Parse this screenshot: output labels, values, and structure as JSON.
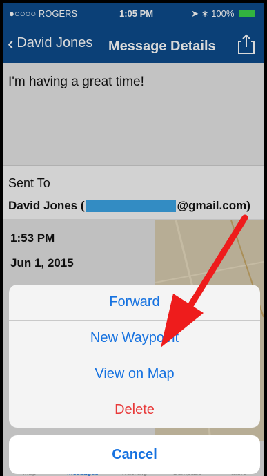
{
  "status_bar": {
    "carrier": "●○○○○ ROGERS",
    "time": "1:05 PM",
    "battery": "100%"
  },
  "nav": {
    "back_label": "David Jones",
    "title": "Message Details"
  },
  "message": {
    "text": "I'm having a great time!"
  },
  "recipient": {
    "label": "Sent To",
    "name_prefix": "David Jones (",
    "email_suffix": "@gmail.com)"
  },
  "details": {
    "time": "1:53 PM",
    "date": "Jun 1, 2015"
  },
  "action_sheet": {
    "items": [
      {
        "label": "Forward",
        "style": "default"
      },
      {
        "label": "New Waypoint",
        "style": "default"
      },
      {
        "label": "View on Map",
        "style": "default"
      },
      {
        "label": "Delete",
        "style": "destructive"
      }
    ],
    "cancel": "Cancel"
  },
  "tab_bar": {
    "items": [
      "Map",
      "Messages",
      "Tracking",
      "Compass",
      "More"
    ]
  },
  "colors": {
    "nav_blue": "#0d4c8c",
    "action_blue": "#1672e0",
    "delete_red": "#e83a3a",
    "arrow_red": "#ee1c1c"
  }
}
